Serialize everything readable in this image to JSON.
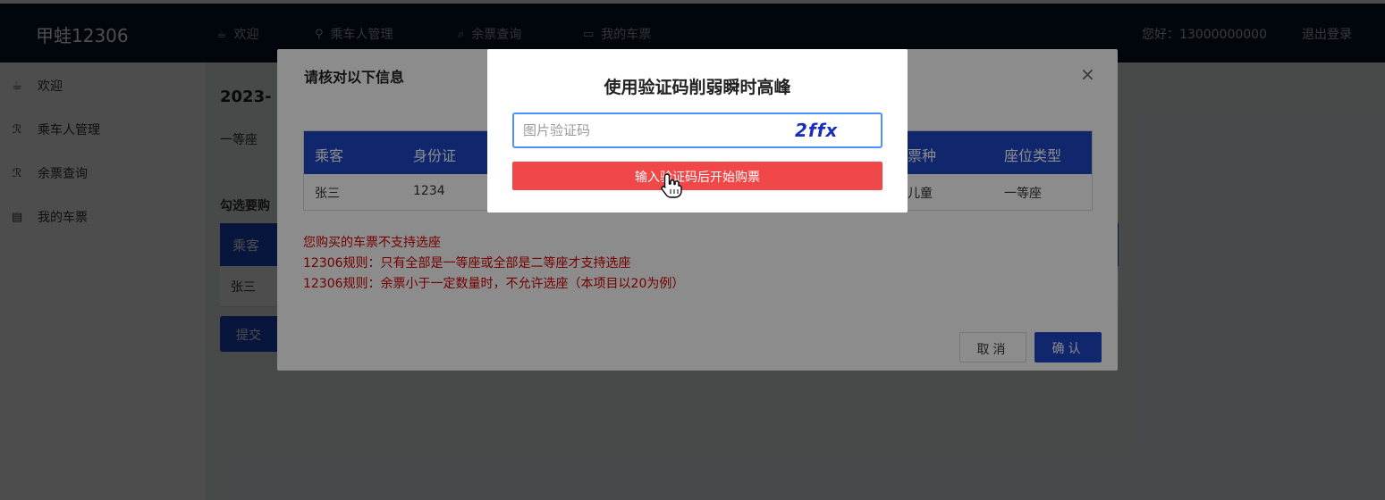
{
  "header": {
    "logo": "甲蛙12306",
    "nav": [
      {
        "icon": "coffee-icon",
        "label": "欢迎"
      },
      {
        "icon": "user-icon",
        "label": "乘车人管理"
      },
      {
        "icon": "search-icon",
        "label": "余票查询"
      },
      {
        "icon": "ticket-icon",
        "label": "我的车票"
      }
    ],
    "greeting": "您好：13000000000",
    "logout": "退出登录"
  },
  "sidebar": {
    "items": [
      {
        "icon": "coffee-icon",
        "label": "欢迎"
      },
      {
        "icon": "user-icon",
        "label": "乘车人管理"
      },
      {
        "icon": "user-icon",
        "label": "余票查询"
      },
      {
        "icon": "ticket-icon",
        "label": "我的车票"
      }
    ]
  },
  "content": {
    "date": "2023-",
    "seat": "一等座",
    "choose_label": "勾选要购",
    "table_head": "乘客",
    "table_cell": "张三",
    "submit": "提交"
  },
  "confirm_modal": {
    "title": "请核对以下信息",
    "close": "×",
    "columns": [
      "乘客",
      "身份证",
      "票种",
      "座位类型"
    ],
    "row": [
      "张三",
      "1234",
      "儿童",
      "一等座"
    ],
    "warnings": [
      "您购买的车票不支持选座",
      "12306规则：只有全部是一等座或全部是二等座才支持选座",
      "12306规则：余票小于一定数量时，不允许选座（本项目以20为例）"
    ],
    "cancel": "取消",
    "ok": "确认"
  },
  "captcha_modal": {
    "title": "使用验证码削弱瞬时高峰",
    "input_placeholder": "图片验证码",
    "captcha_text": "2ffx",
    "button": "输入验证码后开始购票"
  },
  "colors": {
    "header_bg": "#001529",
    "primary": "#1e48c8",
    "danger": "#f04848",
    "warning_text": "#d40000"
  }
}
